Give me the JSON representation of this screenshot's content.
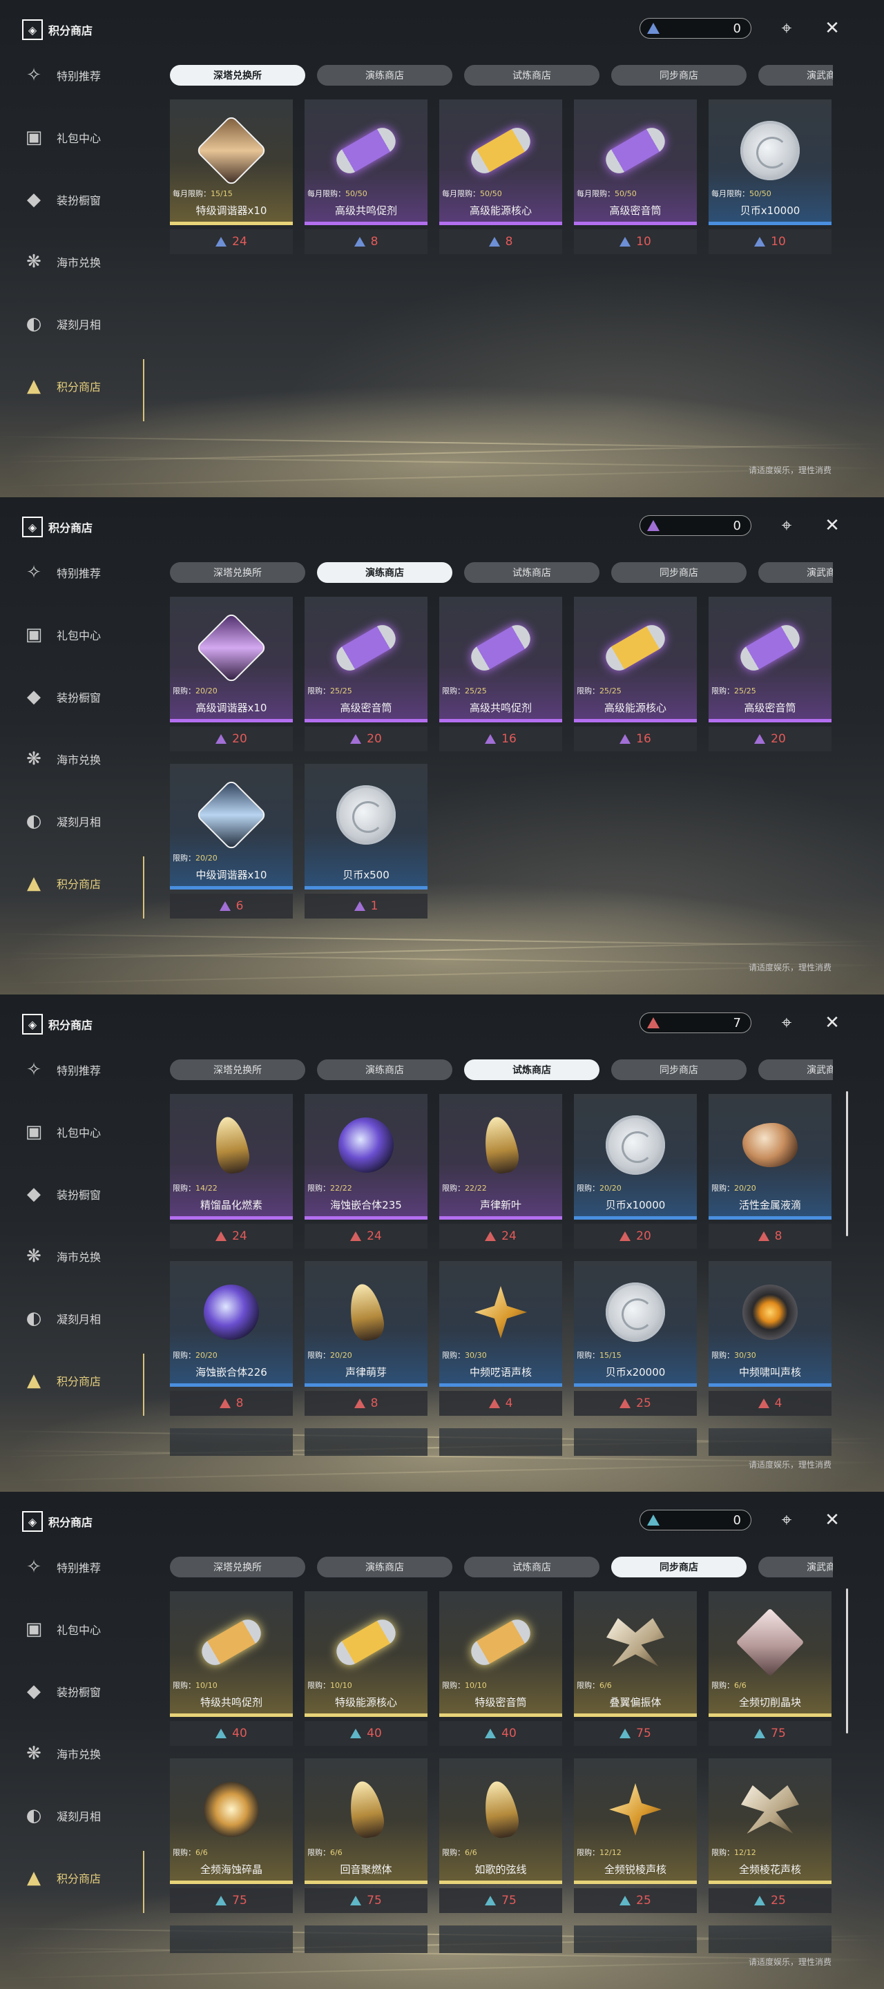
{
  "screens": [
    {
      "title": "积分商店",
      "currency": {
        "value": "0",
        "color": "#6d8fd6"
      },
      "active_tab": 0,
      "cards": [
        {
          "limit_label": "每月限购：",
          "limit": "15/15",
          "name": "特级调谐器x10",
          "price": "24",
          "quality": "gold",
          "icon": "tuner-gem-icon"
        },
        {
          "limit_label": "每月限购：",
          "limit": "50/50",
          "name": "高级共鸣促剂",
          "price": "8",
          "quality": "purple",
          "icon": "vial-icon"
        },
        {
          "limit_label": "每月限购：",
          "limit": "50/50",
          "name": "高级能源核心",
          "price": "8",
          "quality": "purple",
          "icon": "energy-core-icon"
        },
        {
          "limit_label": "每月限购：",
          "limit": "50/50",
          "name": "高级密音筒",
          "price": "10",
          "quality": "purple",
          "icon": "sealed-tube-icon"
        },
        {
          "limit_label": "每月限购：",
          "limit": "50/50",
          "name": "贝币x10000",
          "price": "10",
          "quality": "blue",
          "icon": "coin-icon"
        }
      ],
      "footer": "请适度娱乐，理性消费"
    },
    {
      "title": "积分商店",
      "currency": {
        "value": "0",
        "color": "#a26fd6"
      },
      "active_tab": 1,
      "cards": [
        {
          "limit_label": "限购：",
          "limit": "20/20",
          "name": "高级调谐器x10",
          "price": "20",
          "quality": "purple",
          "icon": "tuner-gem-icon"
        },
        {
          "limit_label": "限购：",
          "limit": "25/25",
          "name": "高级密音筒",
          "price": "20",
          "quality": "purple",
          "icon": "sealed-tube-icon"
        },
        {
          "limit_label": "限购：",
          "limit": "25/25",
          "name": "高级共鸣促剂",
          "price": "16",
          "quality": "purple",
          "icon": "vial-icon"
        },
        {
          "limit_label": "限购：",
          "limit": "25/25",
          "name": "高级能源核心",
          "price": "16",
          "quality": "purple",
          "icon": "energy-core-icon"
        },
        {
          "limit_label": "限购：",
          "limit": "25/25",
          "name": "高级密音筒",
          "price": "20",
          "quality": "purple",
          "icon": "sealed-tube-icon"
        },
        {
          "limit_label": "限购：",
          "limit": "20/20",
          "name": "中级调谐器x10",
          "price": "6",
          "quality": "blue",
          "icon": "tuner-gem-icon"
        },
        {
          "limit_label": "",
          "limit": "",
          "name": "贝币x500",
          "price": "1",
          "quality": "blue",
          "icon": "coin-icon"
        }
      ],
      "footer": "请适度娱乐，理性消费"
    },
    {
      "title": "积分商店",
      "currency": {
        "value": "7",
        "color": "#d66060"
      },
      "active_tab": 2,
      "cards": [
        {
          "limit_label": "限购：",
          "limit": "14/22",
          "name": "精馏晶化燃素",
          "price": "24",
          "quality": "purple",
          "icon": "flame-crystal-icon"
        },
        {
          "limit_label": "限购：",
          "limit": "22/22",
          "name": "海蚀嵌合体235",
          "price": "24",
          "quality": "purple",
          "icon": "orb-icon"
        },
        {
          "limit_label": "限购：",
          "limit": "22/22",
          "name": "声律新叶",
          "price": "24",
          "quality": "purple",
          "icon": "flame-leaf-icon"
        },
        {
          "limit_label": "限购：",
          "limit": "20/20",
          "name": "贝币x10000",
          "price": "20",
          "quality": "blue",
          "icon": "coin-icon"
        },
        {
          "limit_label": "限购：",
          "limit": "20/20",
          "name": "活性金属液滴",
          "price": "8",
          "quality": "blue",
          "icon": "metal-drop-icon"
        },
        {
          "limit_label": "限购：",
          "limit": "20/20",
          "name": "海蚀嵌合体226",
          "price": "8",
          "quality": "blue",
          "icon": "orb-icon"
        },
        {
          "limit_label": "限购：",
          "limit": "20/20",
          "name": "声律萌芽",
          "price": "8",
          "quality": "blue",
          "icon": "flame-leaf-icon"
        },
        {
          "limit_label": "限购：",
          "limit": "30/30",
          "name": "中频呓语声核",
          "price": "4",
          "quality": "blue",
          "icon": "star-core-icon"
        },
        {
          "limit_label": "限购：",
          "limit": "15/15",
          "name": "贝币x20000",
          "price": "25",
          "quality": "blue",
          "icon": "coin-icon"
        },
        {
          "limit_label": "限购：",
          "limit": "30/30",
          "name": "中频啸叫声核",
          "price": "4",
          "quality": "blue",
          "icon": "sound-core-icon"
        }
      ],
      "footer": "请适度娱乐，理性消费"
    },
    {
      "title": "积分商店",
      "currency": {
        "value": "0",
        "color": "#5fb7c7"
      },
      "active_tab": 3,
      "cards": [
        {
          "limit_label": "限购：",
          "limit": "10/10",
          "name": "特级共鸣促剂",
          "price": "40",
          "quality": "gold",
          "icon": "vial-icon"
        },
        {
          "limit_label": "限购：",
          "limit": "10/10",
          "name": "特级能源核心",
          "price": "40",
          "quality": "gold",
          "icon": "energy-core-icon"
        },
        {
          "limit_label": "限购：",
          "limit": "10/10",
          "name": "特级密音筒",
          "price": "40",
          "quality": "gold",
          "icon": "sealed-tube-icon"
        },
        {
          "limit_label": "限购：",
          "limit": "6/6",
          "name": "叠翼偏振体",
          "price": "75",
          "quality": "gold",
          "icon": "butterfly-icon"
        },
        {
          "limit_label": "限购：",
          "limit": "6/6",
          "name": "全频切削晶块",
          "price": "75",
          "quality": "gold",
          "icon": "cube-crystal-icon"
        },
        {
          "limit_label": "限购：",
          "limit": "6/6",
          "name": "全频海蚀碎晶",
          "price": "75",
          "quality": "gold",
          "icon": "shard-orb-icon"
        },
        {
          "limit_label": "限购：",
          "limit": "6/6",
          "name": "回音聚燃体",
          "price": "75",
          "quality": "gold",
          "icon": "feather-flame-icon"
        },
        {
          "limit_label": "限购：",
          "limit": "6/6",
          "name": "如歌的弦线",
          "price": "75",
          "quality": "gold",
          "icon": "string-icon"
        },
        {
          "limit_label": "限购：",
          "limit": "12/12",
          "name": "全频锐棱声核",
          "price": "25",
          "quality": "gold",
          "icon": "prism-core-icon"
        },
        {
          "limit_label": "限购：",
          "limit": "12/12",
          "name": "全频棱花声核",
          "price": "25",
          "quality": "gold",
          "icon": "flower-core-icon"
        }
      ],
      "footer": "请适度娱乐，理性消费"
    }
  ],
  "sidebar": {
    "items": [
      {
        "label": "特别推荐",
        "icon": "recommend-icon"
      },
      {
        "label": "礼包中心",
        "icon": "gift-icon"
      },
      {
        "label": "装扮橱窗",
        "icon": "wardrobe-icon"
      },
      {
        "label": "海市兑换",
        "icon": "coral-icon"
      },
      {
        "label": "凝刻月相",
        "icon": "moon-icon"
      },
      {
        "label": "积分商店",
        "icon": "points-icon"
      }
    ]
  },
  "tabs": [
    "深塔兑换所",
    "演练商店",
    "试炼商店",
    "同步商店",
    "演武商店"
  ],
  "top_icons": [
    "target-icon",
    "close-icon"
  ]
}
